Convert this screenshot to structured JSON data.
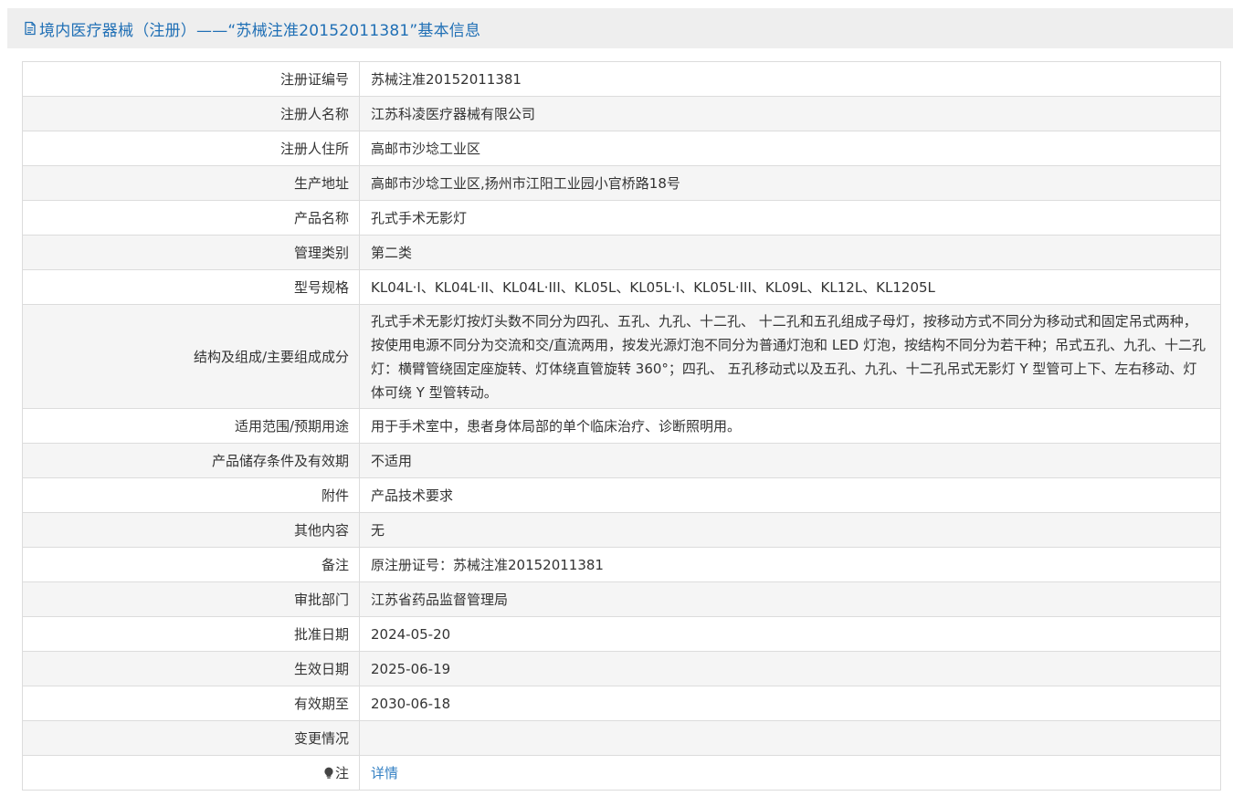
{
  "header": {
    "title": "境内医疗器械（注册）——“苏械注准20152011381”基本信息",
    "icon": "document-icon"
  },
  "rows": [
    {
      "label": "注册证编号",
      "value": "苏械注准20152011381"
    },
    {
      "label": "注册人名称",
      "value": "江苏科凌医疗器械有限公司"
    },
    {
      "label": "注册人住所",
      "value": "高邮市沙埝工业区"
    },
    {
      "label": "生产地址",
      "value": "高邮市沙埝工业区,扬州市江阳工业园小官桥路18号"
    },
    {
      "label": "产品名称",
      "value": "孔式手术无影灯"
    },
    {
      "label": "管理类别",
      "value": "第二类"
    },
    {
      "label": "型号规格",
      "value": "KL04L·I、KL04L·II、KL04L·III、KL05L、KL05L·I、KL05L·III、KL09L、KL12L、KL1205L"
    },
    {
      "label": "结构及组成/主要组成成分",
      "value": "孔式手术无影灯按灯头数不同分为四孔、五孔、九孔、十二孔、 十二孔和五孔组成子母灯，按移动方式不同分为移动式和固定吊式两种，按使用电源不同分为交流和交/直流两用，按发光源灯泡不同分为普通灯泡和 LED 灯泡，按结构不同分为若干种；吊式五孔、九孔、十二孔灯：横臂管绕固定座旋转、灯体绕直管旋转 360°；四孔、 五孔移动式以及五孔、九孔、十二孔吊式无影灯 Y 型管可上下、左右移动、灯体可绕 Y 型管转动。"
    },
    {
      "label": "适用范围/预期用途",
      "value": "用于手术室中，患者身体局部的单个临床治疗、诊断照明用。"
    },
    {
      "label": "产品储存条件及有效期",
      "value": "不适用"
    },
    {
      "label": "附件",
      "value": "产品技术要求"
    },
    {
      "label": "其他内容",
      "value": "无"
    },
    {
      "label": "备注",
      "value": "原注册证号：苏械注准20152011381"
    },
    {
      "label": "审批部门",
      "value": "江苏省药品监督管理局"
    },
    {
      "label": "批准日期",
      "value": "2024-05-20"
    },
    {
      "label": "生效日期",
      "value": "2025-06-19"
    },
    {
      "label": "有效期至",
      "value": "2030-06-18"
    },
    {
      "label": "变更情况",
      "value": ""
    }
  ],
  "note": {
    "label": "注",
    "icon": "lightbulb-icon",
    "link_text": "详情",
    "link_color": "#3581c4"
  },
  "colors": {
    "title": "#1f6fb5",
    "header_bg": "#eeeeee",
    "alt_row_bg": "#f5f5f5",
    "border": "#dcdcdc"
  }
}
